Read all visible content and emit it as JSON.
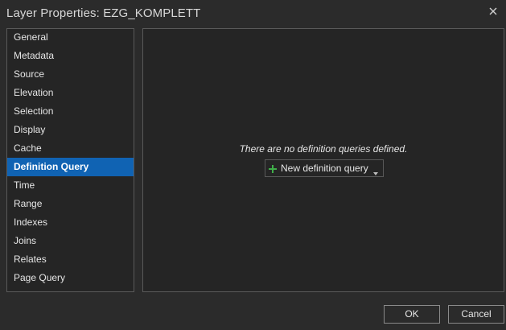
{
  "window": {
    "title": "Layer Properties: EZG_KOMPLETT"
  },
  "sidebar": {
    "items": [
      {
        "label": "General"
      },
      {
        "label": "Metadata"
      },
      {
        "label": "Source"
      },
      {
        "label": "Elevation"
      },
      {
        "label": "Selection"
      },
      {
        "label": "Display"
      },
      {
        "label": "Cache"
      },
      {
        "label": "Definition Query",
        "selected": true
      },
      {
        "label": "Time"
      },
      {
        "label": "Range"
      },
      {
        "label": "Indexes"
      },
      {
        "label": "Joins"
      },
      {
        "label": "Relates"
      },
      {
        "label": "Page Query"
      }
    ],
    "selected_color": "#1063b3"
  },
  "main": {
    "empty_message": "There are no definition queries defined.",
    "new_query_label": "New definition query",
    "icons": {
      "add": "plus-icon",
      "dropdown": "caret-down-icon"
    },
    "plus_color": "#3fae49"
  },
  "footer": {
    "ok_label": "OK",
    "cancel_label": "Cancel"
  }
}
